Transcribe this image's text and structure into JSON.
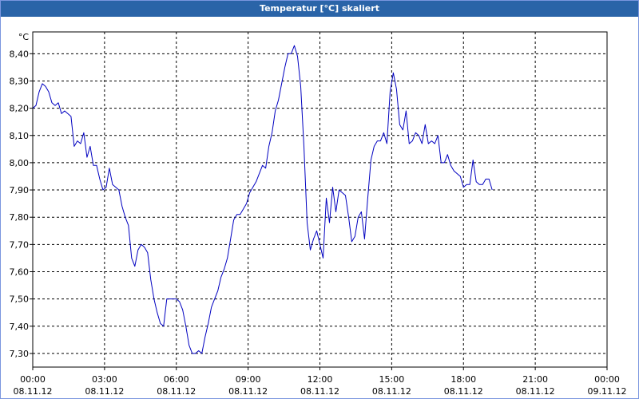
{
  "window": {
    "title": "Temperatur [°C] skaliert"
  },
  "chart_data": {
    "type": "line",
    "title": "Temperatur [°C] skaliert",
    "ylabel": "°C",
    "ylim": [
      7.25,
      8.48
    ],
    "xlim": [
      "2012-11-08 00:00",
      "2012-11-09 00:00"
    ],
    "yticks": [
      {
        "value": 7.3,
        "label": "7,30"
      },
      {
        "value": 7.4,
        "label": "7,40"
      },
      {
        "value": 7.5,
        "label": "7,50"
      },
      {
        "value": 7.6,
        "label": "7,60"
      },
      {
        "value": 7.7,
        "label": "7,70"
      },
      {
        "value": 7.8,
        "label": "7,80"
      },
      {
        "value": 7.9,
        "label": "7,90"
      },
      {
        "value": 8.0,
        "label": "8,00"
      },
      {
        "value": 8.1,
        "label": "8,10"
      },
      {
        "value": 8.2,
        "label": "8,20"
      },
      {
        "value": 8.3,
        "label": "8,30"
      },
      {
        "value": 8.4,
        "label": "8,40"
      }
    ],
    "xticks": [
      {
        "value": "2012-11-08 00:00",
        "time": "00:00",
        "date": "08.11.12"
      },
      {
        "value": "2012-11-08 03:00",
        "time": "03:00",
        "date": "08.11.12"
      },
      {
        "value": "2012-11-08 06:00",
        "time": "06:00",
        "date": "08.11.12"
      },
      {
        "value": "2012-11-08 09:00",
        "time": "09:00",
        "date": "08.11.12"
      },
      {
        "value": "2012-11-08 12:00",
        "time": "12:00",
        "date": "08.11.12"
      },
      {
        "value": "2012-11-08 15:00",
        "time": "15:00",
        "date": "08.11.12"
      },
      {
        "value": "2012-11-08 18:00",
        "time": "18:00",
        "date": "08.11.12"
      },
      {
        "value": "2012-11-08 21:00",
        "time": "21:00",
        "date": "08.11.12"
      },
      {
        "value": "2012-11-09 00:00",
        "time": "00:00",
        "date": "09.11.12"
      }
    ],
    "grid": true,
    "series": [
      {
        "color": "#0000c0",
        "points": [
          [
            "2012-11-08 00:00",
            8.2
          ],
          [
            "2012-11-08 00:08",
            8.21
          ],
          [
            "2012-11-08 00:16",
            8.26
          ],
          [
            "2012-11-08 00:24",
            8.29
          ],
          [
            "2012-11-08 00:32",
            8.28
          ],
          [
            "2012-11-08 00:40",
            8.26
          ],
          [
            "2012-11-08 00:48",
            8.22
          ],
          [
            "2012-11-08 00:56",
            8.21
          ],
          [
            "2012-11-08 01:04",
            8.22
          ],
          [
            "2012-11-08 01:12",
            8.18
          ],
          [
            "2012-11-08 01:20",
            8.19
          ],
          [
            "2012-11-08 01:28",
            8.18
          ],
          [
            "2012-11-08 01:36",
            8.17
          ],
          [
            "2012-11-08 01:44",
            8.06
          ],
          [
            "2012-11-08 01:52",
            8.08
          ],
          [
            "2012-11-08 02:00",
            8.07
          ],
          [
            "2012-11-08 02:08",
            8.11
          ],
          [
            "2012-11-08 02:16",
            8.02
          ],
          [
            "2012-11-08 02:24",
            8.06
          ],
          [
            "2012-11-08 02:32",
            7.99
          ],
          [
            "2012-11-08 02:40",
            7.99
          ],
          [
            "2012-11-08 02:48",
            7.94
          ],
          [
            "2012-11-08 02:56",
            7.9
          ],
          [
            "2012-11-08 03:04",
            7.91
          ],
          [
            "2012-11-08 03:12",
            7.98
          ],
          [
            "2012-11-08 03:20",
            7.92
          ],
          [
            "2012-11-08 03:28",
            7.91
          ],
          [
            "2012-11-08 03:36",
            7.9
          ],
          [
            "2012-11-08 03:44",
            7.84
          ],
          [
            "2012-11-08 03:52",
            7.8
          ],
          [
            "2012-11-08 04:00",
            7.77
          ],
          [
            "2012-11-08 04:08",
            7.65
          ],
          [
            "2012-11-08 04:16",
            7.62
          ],
          [
            "2012-11-08 04:24",
            7.68
          ],
          [
            "2012-11-08 04:32",
            7.7
          ],
          [
            "2012-11-08 04:40",
            7.69
          ],
          [
            "2012-11-08 04:48",
            7.67
          ],
          [
            "2012-11-08 04:56",
            7.57
          ],
          [
            "2012-11-08 05:04",
            7.5
          ],
          [
            "2012-11-08 05:12",
            7.45
          ],
          [
            "2012-11-08 05:20",
            7.41
          ],
          [
            "2012-11-08 05:28",
            7.4
          ],
          [
            "2012-11-08 05:36",
            7.5
          ],
          [
            "2012-11-08 05:44",
            7.5
          ],
          [
            "2012-11-08 05:52",
            7.5
          ],
          [
            "2012-11-08 06:00",
            7.5
          ],
          [
            "2012-11-08 06:08",
            7.49
          ],
          [
            "2012-11-08 06:16",
            7.46
          ],
          [
            "2012-11-08 06:24",
            7.4
          ],
          [
            "2012-11-08 06:32",
            7.33
          ],
          [
            "2012-11-08 06:40",
            7.3
          ],
          [
            "2012-11-08 06:48",
            7.3
          ],
          [
            "2012-11-08 06:56",
            7.31
          ],
          [
            "2012-11-08 07:04",
            7.3
          ],
          [
            "2012-11-08 07:12",
            7.36
          ],
          [
            "2012-11-08 07:20",
            7.41
          ],
          [
            "2012-11-08 07:28",
            7.47
          ],
          [
            "2012-11-08 07:36",
            7.5
          ],
          [
            "2012-11-08 07:44",
            7.53
          ],
          [
            "2012-11-08 07:52",
            7.58
          ],
          [
            "2012-11-08 08:00",
            7.61
          ],
          [
            "2012-11-08 08:08",
            7.65
          ],
          [
            "2012-11-08 08:16",
            7.72
          ],
          [
            "2012-11-08 08:24",
            7.79
          ],
          [
            "2012-11-08 08:32",
            7.81
          ],
          [
            "2012-11-08 08:40",
            7.81
          ],
          [
            "2012-11-08 08:48",
            7.83
          ],
          [
            "2012-11-08 08:56",
            7.85
          ],
          [
            "2012-11-08 09:04",
            7.89
          ],
          [
            "2012-11-08 09:12",
            7.91
          ],
          [
            "2012-11-08 09:20",
            7.93
          ],
          [
            "2012-11-08 09:28",
            7.96
          ],
          [
            "2012-11-08 09:36",
            7.99
          ],
          [
            "2012-11-08 09:44",
            7.98
          ],
          [
            "2012-11-08 09:52",
            8.06
          ],
          [
            "2012-11-08 10:00",
            8.11
          ],
          [
            "2012-11-08 10:08",
            8.19
          ],
          [
            "2012-11-08 10:16",
            8.23
          ],
          [
            "2012-11-08 10:24",
            8.29
          ],
          [
            "2012-11-08 10:32",
            8.35
          ],
          [
            "2012-11-08 10:40",
            8.4
          ],
          [
            "2012-11-08 10:48",
            8.4
          ],
          [
            "2012-11-08 10:56",
            8.43
          ],
          [
            "2012-11-08 11:04",
            8.39
          ],
          [
            "2012-11-08 11:12",
            8.28
          ],
          [
            "2012-11-08 11:20",
            8.06
          ],
          [
            "2012-11-08 11:28",
            7.78
          ],
          [
            "2012-11-08 11:36",
            7.68
          ],
          [
            "2012-11-08 11:44",
            7.72
          ],
          [
            "2012-11-08 11:52",
            7.75
          ],
          [
            "2012-11-08 12:00",
            7.7
          ],
          [
            "2012-11-08 12:08",
            7.65
          ],
          [
            "2012-11-08 12:16",
            7.87
          ],
          [
            "2012-11-08 12:24",
            7.78
          ],
          [
            "2012-11-08 12:32",
            7.91
          ],
          [
            "2012-11-08 12:40",
            7.82
          ],
          [
            "2012-11-08 12:48",
            7.9
          ],
          [
            "2012-11-08 12:56",
            7.89
          ],
          [
            "2012-11-08 13:04",
            7.88
          ],
          [
            "2012-11-08 13:12",
            7.8
          ],
          [
            "2012-11-08 13:20",
            7.71
          ],
          [
            "2012-11-08 13:28",
            7.73
          ],
          [
            "2012-11-08 13:36",
            7.8
          ],
          [
            "2012-11-08 13:44",
            7.82
          ],
          [
            "2012-11-08 13:52",
            7.72
          ],
          [
            "2012-11-08 14:00",
            7.87
          ],
          [
            "2012-11-08 14:08",
            8.01
          ],
          [
            "2012-11-08 14:16",
            8.06
          ],
          [
            "2012-11-08 14:24",
            8.08
          ],
          [
            "2012-11-08 14:32",
            8.08
          ],
          [
            "2012-11-08 14:40",
            8.11
          ],
          [
            "2012-11-08 14:48",
            8.07
          ],
          [
            "2012-11-08 14:56",
            8.26
          ],
          [
            "2012-11-08 15:04",
            8.33
          ],
          [
            "2012-11-08 15:12",
            8.27
          ],
          [
            "2012-11-08 15:20",
            8.14
          ],
          [
            "2012-11-08 15:28",
            8.12
          ],
          [
            "2012-11-08 15:36",
            8.19
          ],
          [
            "2012-11-08 15:44",
            8.07
          ],
          [
            "2012-11-08 15:52",
            8.08
          ],
          [
            "2012-11-08 16:00",
            8.11
          ],
          [
            "2012-11-08 16:08",
            8.1
          ],
          [
            "2012-11-08 16:16",
            8.07
          ],
          [
            "2012-11-08 16:24",
            8.14
          ],
          [
            "2012-11-08 16:32",
            8.07
          ],
          [
            "2012-11-08 16:40",
            8.08
          ],
          [
            "2012-11-08 16:48",
            8.07
          ],
          [
            "2012-11-08 16:56",
            8.1
          ],
          [
            "2012-11-08 17:04",
            8.0
          ],
          [
            "2012-11-08 17:12",
            8.0
          ],
          [
            "2012-11-08 17:20",
            8.03
          ],
          [
            "2012-11-08 17:28",
            7.99
          ],
          [
            "2012-11-08 17:36",
            7.97
          ],
          [
            "2012-11-08 17:44",
            7.96
          ],
          [
            "2012-11-08 17:52",
            7.95
          ],
          [
            "2012-11-08 18:00",
            7.91
          ],
          [
            "2012-11-08 18:08",
            7.92
          ],
          [
            "2012-11-08 18:16",
            7.92
          ],
          [
            "2012-11-08 18:24",
            8.01
          ],
          [
            "2012-11-08 18:32",
            7.93
          ],
          [
            "2012-11-08 18:40",
            7.92
          ],
          [
            "2012-11-08 18:48",
            7.92
          ],
          [
            "2012-11-08 18:56",
            7.94
          ],
          [
            "2012-11-08 19:04",
            7.94
          ],
          [
            "2012-11-08 19:12",
            7.9
          ]
        ]
      }
    ]
  }
}
